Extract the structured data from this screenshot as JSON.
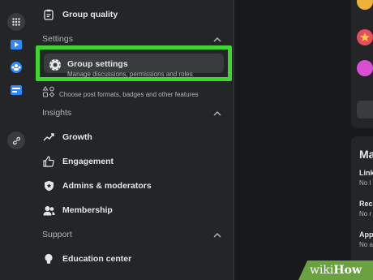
{
  "sidebar": {
    "top_item": "Group quality",
    "settings_header": "Settings",
    "group_settings": {
      "title": "Group settings",
      "subtitle": "Manage discussions, permissions and roles"
    },
    "features_subtitle": "Choose post formats, badges and other features",
    "insights_header": "Insights",
    "insights_items": [
      "Growth",
      "Engagement",
      "Admins & moderators",
      "Membership"
    ],
    "support_header": "Support",
    "support_items": [
      "Education center"
    ]
  },
  "right_panel": {
    "title": "Ma",
    "rows": [
      {
        "label": "Link",
        "sub": "No l"
      },
      {
        "label": "Rec",
        "sub": "No r"
      },
      {
        "label": "App",
        "sub": "No a"
      }
    ]
  },
  "watermark": {
    "part1": "wiki",
    "part2": "How"
  },
  "colors": {
    "highlight": "#3fd72f",
    "accent": "#2d88ff",
    "watermark": "#6aa242"
  }
}
